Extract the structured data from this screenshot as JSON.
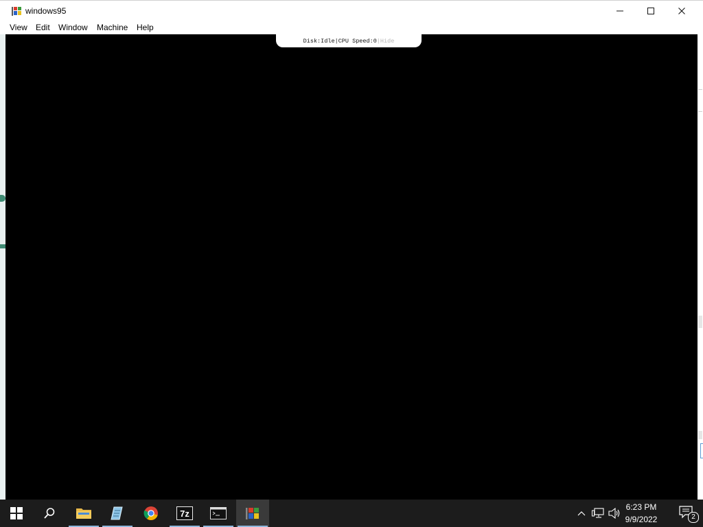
{
  "window": {
    "title": "windows95",
    "app_icon": "windows95-flag-icon",
    "controls": [
      "minimize-icon",
      "maximize-icon",
      "close-icon"
    ]
  },
  "menu": {
    "items": [
      {
        "label": "View"
      },
      {
        "label": "Edit"
      },
      {
        "label": "Window"
      },
      {
        "label": "Machine"
      },
      {
        "label": "Help"
      }
    ]
  },
  "status": {
    "disk_label": "Disk:",
    "disk_value": "Idle",
    "separator": "|",
    "cpu_label": "CPU Speed:",
    "cpu_value": "0",
    "hide_label": "Hide"
  },
  "taskbar": {
    "items": [
      {
        "icon": "windows-start-icon"
      },
      {
        "icon": "search-icon"
      },
      {
        "icon": "file-explorer-icon"
      },
      {
        "icon": "notepad-icon"
      },
      {
        "icon": "chrome-icon"
      },
      {
        "icon": "7zip-icon",
        "text": "7z"
      },
      {
        "icon": "terminal-icon"
      },
      {
        "icon": "windows95-app-icon"
      }
    ],
    "tray_icons": [
      "chevron-up-icon",
      "network-icon",
      "volume-icon"
    ],
    "clock": {
      "time": "6:23 PM",
      "date": "9/9/2022"
    },
    "notifications": {
      "count": "2"
    }
  },
  "colors": {
    "viewport": "#000000",
    "taskbar": "#1c1c1c",
    "accent": "#8fb8dd"
  }
}
